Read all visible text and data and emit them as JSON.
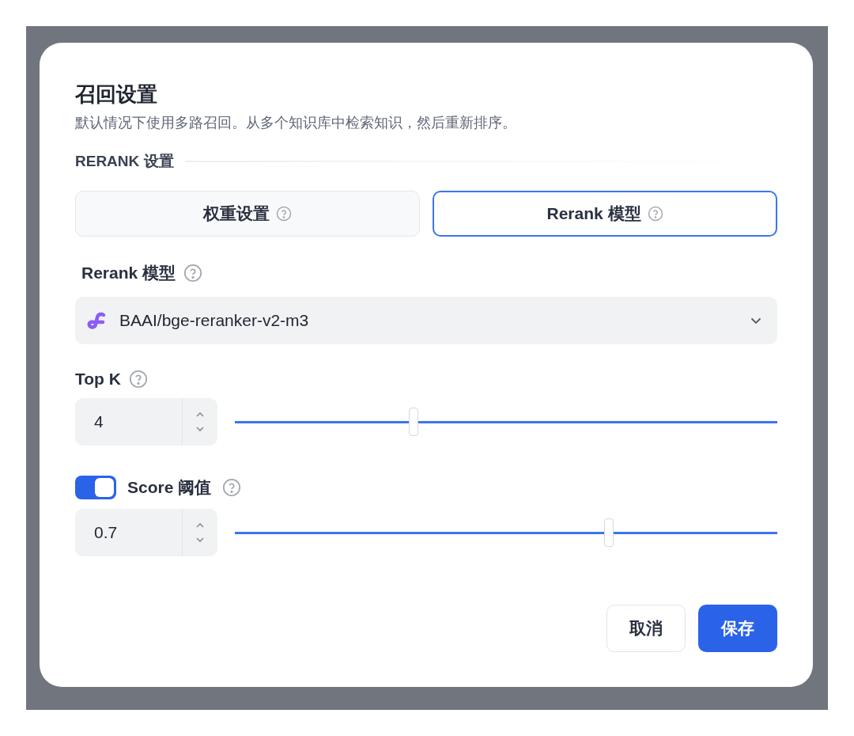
{
  "dialog": {
    "title": "召回设置",
    "description": "默认情况下使用多路召回。从多个知识库中检索知识，然后重新排序。",
    "section": "RERANK 设置",
    "modes": [
      {
        "label": "权重设置",
        "selected": false
      },
      {
        "label": "Rerank 模型",
        "selected": true
      }
    ],
    "model": {
      "label": "Rerank 模型",
      "value": "BAAI/bge-reranker-v2-m3"
    },
    "top_k": {
      "label": "Top K",
      "value": "4",
      "level": 0.33
    },
    "score": {
      "label": "Score 阈值",
      "on": true,
      "value": "0.7",
      "level": 0.69
    },
    "buttons": [
      {
        "label": "取消",
        "kind": "secondary"
      },
      {
        "label": "保存",
        "kind": "primary"
      }
    ]
  }
}
